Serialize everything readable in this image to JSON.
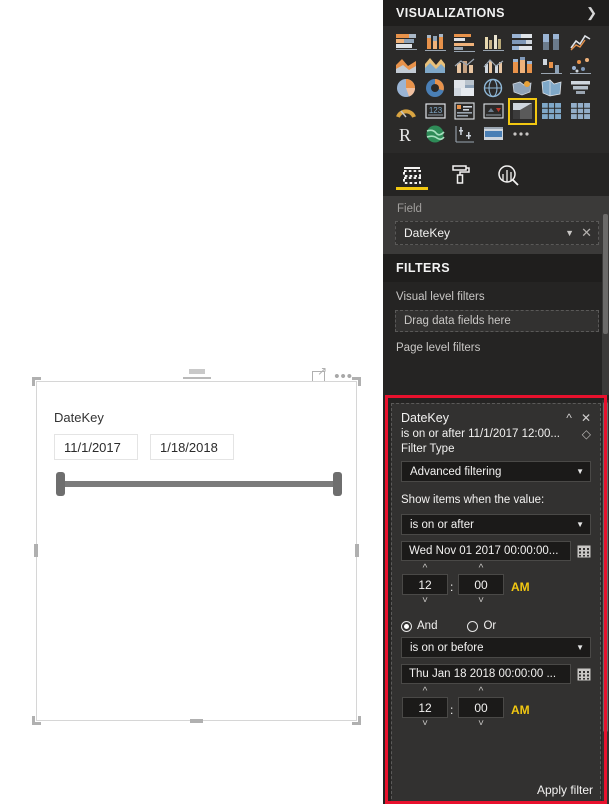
{
  "canvas": {
    "visual": {
      "title": "DateKey",
      "start_date": "11/1/2017",
      "end_date": "1/18/2018",
      "focus_icon": "focus-mode-icon",
      "more_icon": "more-options-icon",
      "drag_icon": "drag-handle-icon"
    }
  },
  "visualizations": {
    "header_title": "VISUALIZATIONS",
    "expand_icon": "chevron-right-icon",
    "icons": [
      "stacked-bar-chart-icon",
      "stacked-column-chart-icon",
      "clustered-bar-chart-icon",
      "clustered-column-chart-icon",
      "100-percent-stacked-bar-chart-icon",
      "100-percent-stacked-column-chart-icon",
      "line-chart-icon",
      "area-chart-icon",
      "stacked-area-chart-icon",
      "line-stacked-column-chart-icon",
      "line-clustered-column-chart-icon",
      "ribbon-chart-icon",
      "waterfall-chart-icon",
      "scatter-chart-icon",
      "pie-chart-icon",
      "donut-chart-icon",
      "treemap-icon",
      "map-icon",
      "filled-map-icon",
      "shape-map-icon",
      "funnel-icon",
      "gauge-icon",
      "card-icon",
      "multi-row-card-icon",
      "kpi-icon",
      "slicer-icon",
      "table-icon",
      "matrix-icon",
      "r-script-visual-icon",
      "arcgis-maps-icon",
      "python-visual-icon",
      "paginated-report-icon",
      "more-visuals-icon"
    ],
    "selected_icon": "slicer-icon",
    "tabs": [
      {
        "name": "fields-tab",
        "icon": "fields-grid-icon",
        "active": true
      },
      {
        "name": "format-tab",
        "icon": "paint-roller-icon",
        "active": false
      },
      {
        "name": "analytics-tab",
        "icon": "analytics-magnifier-icon",
        "active": false
      }
    ]
  },
  "field_well": {
    "label": "Field",
    "chip_value": "DateKey",
    "dropdown_icon": "chevron-down-icon",
    "remove_icon": "close-icon"
  },
  "filters": {
    "header_title": "FILTERS",
    "visual_level_label": "Visual level filters",
    "drag_placeholder": "Drag data fields here",
    "page_level_label": "Page level filters"
  },
  "filter_card": {
    "title": "DateKey",
    "summary": "is on or after 11/1/2017 12:00...",
    "collapse_icon": "chevron-up-icon",
    "remove_icon": "close-icon",
    "clear_icon": "eraser-icon",
    "filter_type_label": "Filter Type",
    "filter_type_value": "Advanced filtering",
    "show_items_label": "Show items when the value:",
    "condition1": "is on or after",
    "date1": "Wed Nov 01 2017 00:00:00...",
    "time1_hour": "12",
    "time1_minute": "00",
    "time1_ampm": "AM",
    "logic_and": "And",
    "logic_or": "Or",
    "logic_selected": "And",
    "condition2": "is on or before",
    "date2": "Thu Jan 18 2018 00:00:00 ...",
    "time2_hour": "12",
    "time2_minute": "00",
    "time2_ampm": "AM",
    "apply_label": "Apply filter",
    "calendar_icon": "calendar-icon",
    "spinner_up_icon": "chevron-up-icon",
    "spinner_down_icon": "chevron-down-icon",
    "colon": ":",
    "highlight_color": "#e8112d"
  }
}
